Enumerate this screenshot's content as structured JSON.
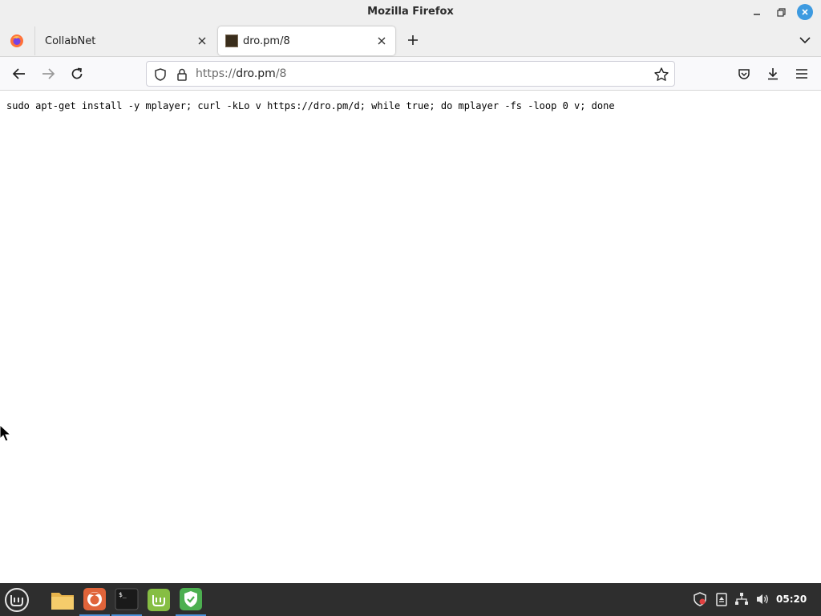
{
  "window": {
    "title": "Mozilla Firefox"
  },
  "tabs": [
    {
      "label": "CollabNet",
      "active": false
    },
    {
      "label": "dro.pm/8",
      "active": true
    }
  ],
  "navbar": {
    "url_scheme": "https://",
    "url_host": "dro.pm",
    "url_path": "/8"
  },
  "content": {
    "text": "sudo apt-get install -y mplayer; curl -kLo v https://dro.pm/d; while true; do mplayer -fs -loop 0 v; done"
  },
  "taskbar": {
    "clock": "05:20",
    "apps": [
      "files-icon",
      "firefox-icon",
      "terminal-icon",
      "mintupdate-icon",
      "shield-icon"
    ]
  },
  "colors": {
    "accent": "#3d9ae0",
    "taskbar_bg": "#2e2e2e",
    "firefox_orange": "#ff7139",
    "mint_green": "#86be43"
  }
}
